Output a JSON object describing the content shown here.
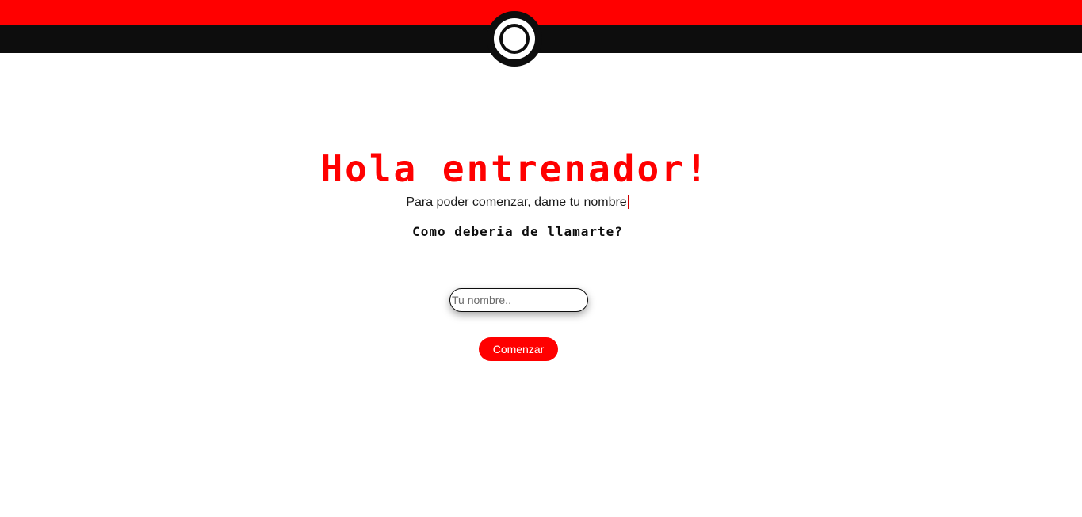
{
  "colors": {
    "accent": "#ff0000",
    "dark": "#0d0d0d",
    "background": "#ffffff"
  },
  "header": {
    "logo_icon": "pokeball-icon"
  },
  "main": {
    "title": "Hola entrenador!",
    "subtitle": "Para poder comenzar, dame tu nombre",
    "question": "Como deberia de llamarte?",
    "name_input": {
      "value": "",
      "placeholder": "Tu nombre.."
    },
    "start_label": "Comenzar"
  }
}
